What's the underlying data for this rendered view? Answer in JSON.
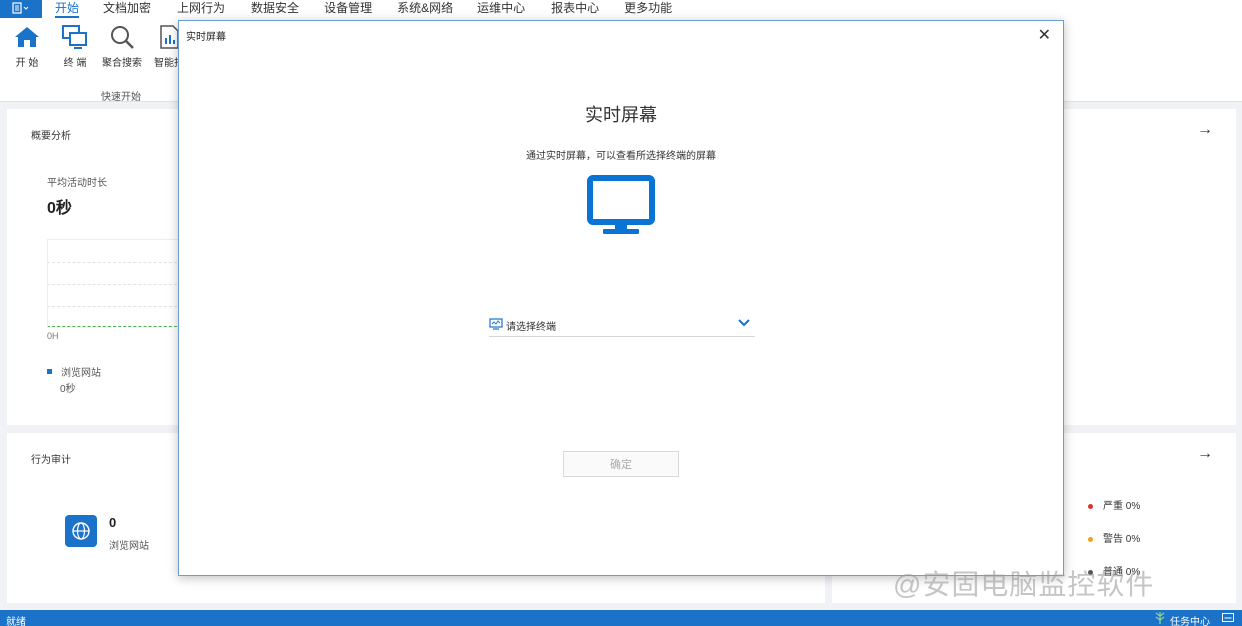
{
  "menu": {
    "app_icon": "document-menu-icon",
    "items": [
      "开始",
      "文档加密",
      "上网行为",
      "数据安全",
      "设备管理",
      "系统&网络",
      "运维中心",
      "报表中心",
      "更多功能"
    ]
  },
  "ribbon": {
    "buttons": [
      {
        "label": "开  始",
        "icon": "home-icon"
      },
      {
        "label": "终  端",
        "icon": "terminal-icon"
      },
      {
        "label": "聚合搜索",
        "icon": "search-icon"
      },
      {
        "label": "智能报",
        "icon": "report-icon"
      }
    ],
    "group_label": "快速开始"
  },
  "overview": {
    "title": "概要分析",
    "metric_label": "平均活动时长",
    "metric_value": "0秒",
    "axis_label": "0H",
    "legend_label": "浏览网站",
    "legend_value": "0秒"
  },
  "audit": {
    "title": "行为审计",
    "count": "0",
    "count_label": "浏览网站"
  },
  "alerts": {
    "items": [
      {
        "label": "严重 0%",
        "color": "#d9342b"
      },
      {
        "label": "警告 0%",
        "color": "#f0a020"
      },
      {
        "label": "普通 0%",
        "color": "#555555"
      }
    ]
  },
  "dialog": {
    "title": "实时屏幕",
    "close_icon": "close-icon",
    "heading": "实时屏幕",
    "description": "通过实时屏幕，可以查看所选择终端的屏幕",
    "monitor_icon": "monitor-icon",
    "select_placeholder": "请选择终端",
    "ok_label": "确定"
  },
  "statusbar": {
    "left": "就绪",
    "right": "任务中心"
  },
  "watermark": "@安固电脑监控软件",
  "colors": {
    "accent": "#1a72c9"
  }
}
